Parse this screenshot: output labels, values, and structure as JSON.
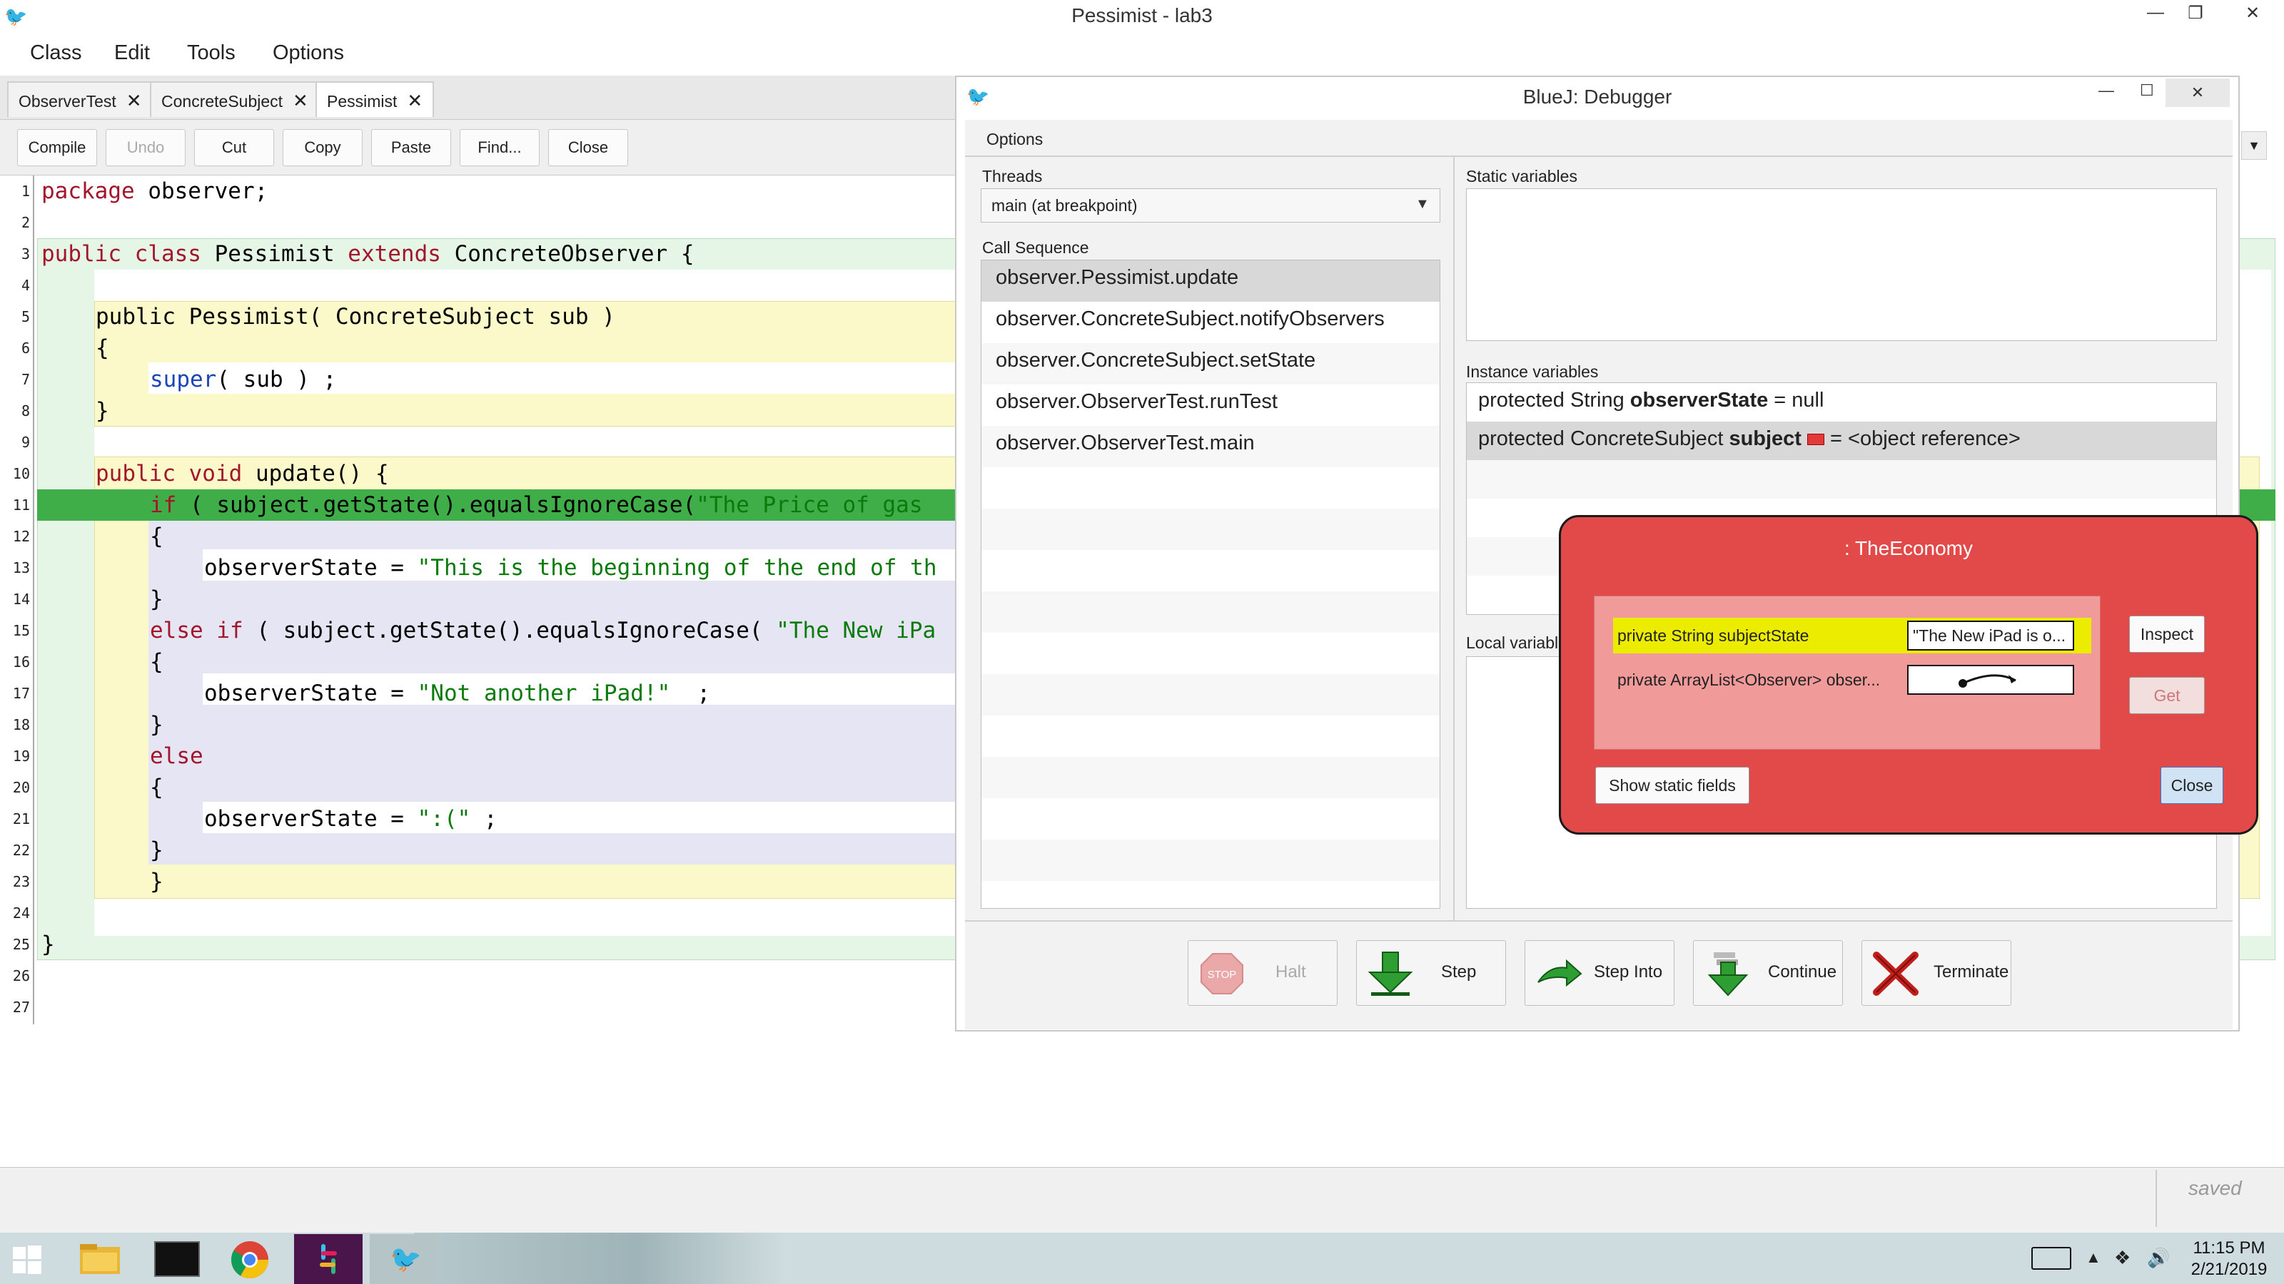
{
  "window": {
    "title": "Pessimist - lab3",
    "minimize_glyph": "—",
    "restore_glyph": "❐",
    "close_glyph": "✕"
  },
  "menu": [
    "Class",
    "Edit",
    "Tools",
    "Options"
  ],
  "tabs": [
    {
      "label": "ObserverTest",
      "close": "✕",
      "active": false
    },
    {
      "label": "ConcreteSubject",
      "close": "✕",
      "active": false
    },
    {
      "label": "Pessimist",
      "close": "✕",
      "active": true
    }
  ],
  "toolbar": {
    "compile": "Compile",
    "undo": "Undo",
    "cut": "Cut",
    "copy": "Copy",
    "paste": "Paste",
    "find": "Find...",
    "close": "Close"
  },
  "editor": {
    "line_numbers": [
      "1",
      "2",
      "3",
      "4",
      "5",
      "6",
      "7",
      "8",
      "9",
      "10",
      "11",
      "12",
      "13",
      "14",
      "15",
      "16",
      "17",
      "18",
      "19",
      "20",
      "21",
      "22",
      "23",
      "24",
      "25",
      "26",
      "27"
    ],
    "lines": {
      "l1_kw": "package",
      "l1_rest": " observer;",
      "l3_kw1": "public class",
      "l3_name": " Pessimist ",
      "l3_kw2": "extends",
      "l3_rest": " ConcreteObserver {",
      "l5": "public Pessimist( ConcreteSubject sub )",
      "l6": "{",
      "l7_call": "super",
      "l7_rest": "( sub ) ;",
      "l8": "}",
      "l10_kw": "public void",
      "l10_rest": " update() {",
      "l11_kw": "if",
      "l11_rest": " ( subject.getState().equalsIgnoreCase(",
      "l11_str": "\"The Price of gas",
      "l12": "{",
      "l13_rest": "observerState = ",
      "l13_str": "\"This is the beginning of the end of th",
      "l14": "}",
      "l15_kw": "else if",
      "l15_rest": " ( subject.getState().equalsIgnoreCase( ",
      "l15_str": "\"The New iPa",
      "l16": "{",
      "l17_rest": "observerState = ",
      "l17_str": "\"Not another iPad!\"",
      "l17_end": "  ;",
      "l18": "}",
      "l19_kw": "else",
      "l20": "{",
      "l21_rest": "observerState = ",
      "l21_str": "\":(\"",
      "l21_end": " ;",
      "l22": "}",
      "l23": "}",
      "l25": "}"
    },
    "status_text": "saved"
  },
  "debugger": {
    "title": "BlueJ:  Debugger",
    "options_menu": "Options",
    "threads_label": "Threads",
    "thread_selected": "main (at breakpoint)",
    "call_sequence_label": "Call Sequence",
    "call_sequence": [
      "observer.Pessimist.update",
      "observer.ConcreteSubject.notifyObservers",
      "observer.ConcreteSubject.setState",
      "observer.ObserverTest.runTest",
      "observer.ObserverTest.main"
    ],
    "static_vars_label": "Static variables",
    "instance_vars_label": "Instance variables",
    "instance_vars": [
      {
        "prefix": "protected  String  ",
        "name": "observerState",
        "suffix": " = null"
      },
      {
        "prefix": "protected  ConcreteSubject  ",
        "name": "subject",
        "suffix": " =  <object reference>"
      }
    ],
    "local_vars_label": "Local variable",
    "buttons": {
      "halt": "Halt",
      "step": "Step",
      "step_into": "Step Into",
      "continue": "Continue",
      "terminate": "Terminate"
    },
    "halt_sign_text": "STOP"
  },
  "inspector": {
    "title": ": TheEconomy",
    "fields": [
      {
        "decl": "private String subjectState",
        "value": "\"The New iPad is o..."
      },
      {
        "decl": "private ArrayList<Observer> obser...",
        "value": ""
      }
    ],
    "inspect": "Inspect",
    "get": "Get",
    "show_static": "Show static fields",
    "close": "Close"
  },
  "taskbar": {
    "time": "11:15 PM",
    "date": "2/21/2019"
  },
  "colors": {
    "class_bg": "#e6f6e6",
    "method_bg": "#fbf8c9",
    "block_bg": "#e5e5f4",
    "breakpoint_line": "#3fae49",
    "inspector_bg": "#e24a4a"
  }
}
